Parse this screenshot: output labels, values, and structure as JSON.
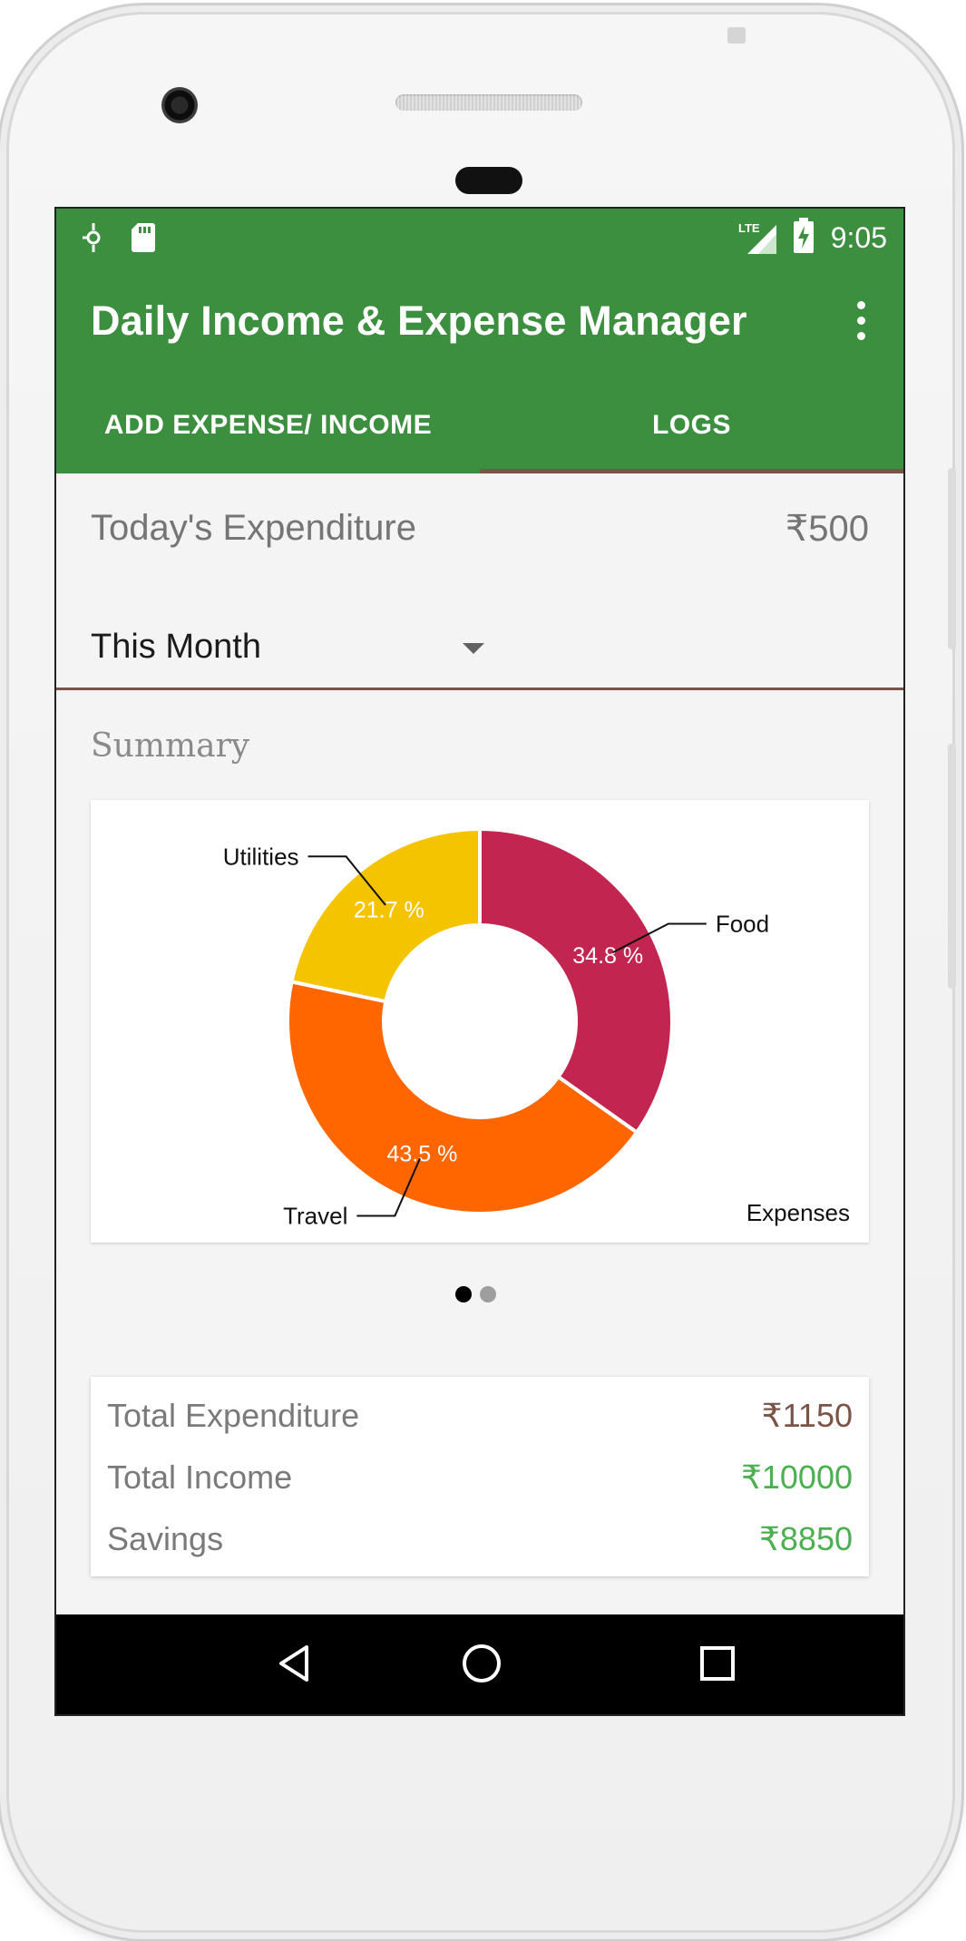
{
  "status_bar": {
    "time": "9:05",
    "network_label": "LTE",
    "icons": [
      "location-icon",
      "sd-card-icon",
      "lte-signal-icon",
      "battery-charging-icon"
    ]
  },
  "app_bar": {
    "title": "Daily Income & Expense Manager",
    "menu_icon": "more-vert-icon",
    "color": "#3b8f3e"
  },
  "tabs": [
    {
      "label": "ADD EXPENSE/ INCOME",
      "selected": false
    },
    {
      "label": "LOGS",
      "selected": true
    }
  ],
  "today": {
    "label": "Today's Expenditure",
    "value": "₹500"
  },
  "period_select": {
    "selected": "This Month"
  },
  "summary": {
    "title": "Summary"
  },
  "chart_data": {
    "type": "pie",
    "donut": true,
    "description": "Expenses",
    "slices": [
      {
        "name": "Food",
        "value": 34.8,
        "label": "34.8 %",
        "color": "#c2254f"
      },
      {
        "name": "Travel",
        "value": 43.5,
        "label": "43.5 %",
        "color": "#ff6600"
      },
      {
        "name": "Utilities",
        "value": 21.7,
        "label": "21.7 %",
        "color": "#f4c400"
      }
    ]
  },
  "pager": {
    "pages": 2,
    "current": 1
  },
  "totals": [
    {
      "label": "Total Expenditure",
      "value": "₹1150",
      "color": "#7b5447"
    },
    {
      "label": "Total Income",
      "value": "₹10000",
      "color": "#4caf50"
    },
    {
      "label": "Savings",
      "value": "₹8850",
      "color": "#4caf50"
    }
  ],
  "nav_bar": {
    "icons": [
      "back-icon",
      "home-icon",
      "recents-icon"
    ]
  }
}
